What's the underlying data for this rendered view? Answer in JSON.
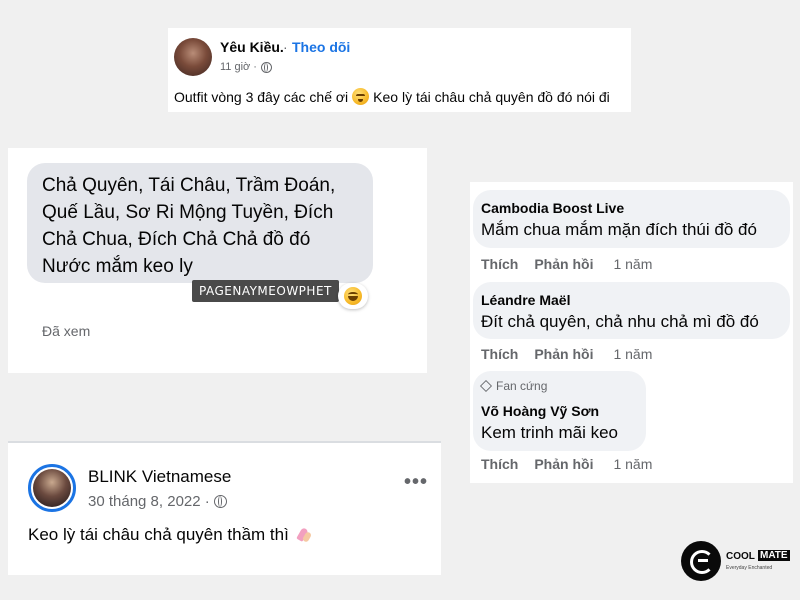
{
  "colors": {
    "background": "#f0f0f0",
    "link_blue": "#1b74e4",
    "secondary_text": "#65676b",
    "bubble_gray": "#e4e6eb",
    "comment_bubble": "#f0f2f5"
  },
  "post_top": {
    "author": "Yêu Kiều.",
    "separator": "·",
    "follow": "Theo dõi",
    "time": "11 giờ ·",
    "caption_before": "Outfit vòng 3 đây các chế ơi",
    "caption_after": "Keo lỳ tái châu chả quyên đồ đó nói đi",
    "icons": [
      "globe-icon",
      "sleepy-emoji-icon"
    ]
  },
  "message": {
    "lines": [
      "Chả Quyên, Tái Châu, Trầm Đoán,",
      "Quế Lầu, Sơ Ri Mộng Tuyền, Đích",
      "Chả Chua, Đích Chả Chả đồ đó",
      "Nước mắm keo ly"
    ],
    "watermark": "PAGENAYMEOWPHET",
    "reaction_icon": "laughing-emoji-icon",
    "seen": "Đã xem"
  },
  "post_blink": {
    "author": "BLINK Vietnamese",
    "date": "30 tháng 8, 2022 ·",
    "more": "•••",
    "caption": "Keo lỳ tái châu chả quyên thầm thì",
    "icons": [
      "globe-icon",
      "nail-polish-icon",
      "more-options-icon"
    ]
  },
  "comments": [
    {
      "name": "Cambodia Boost Live",
      "text": "Mắm chua mắm mặn đích thúi đồ đó",
      "like": "Thích",
      "reply": "Phản hồi",
      "time": "1 năm"
    },
    {
      "name": "Léandre Maël",
      "text": "Đít chả quyên, chả nhu chả mì đồ đó",
      "like": "Thích",
      "reply": "Phản hồi",
      "time": "1 năm"
    },
    {
      "badge": "Fan cứng",
      "name": "Võ Hoàng Vỹ Sơn",
      "text": "Kem trinh mãi keo",
      "like": "Thích",
      "reply": "Phản hồi",
      "time": "1 năm"
    }
  ],
  "logo": {
    "word1": "COOL",
    "word2": "MATE",
    "tagline": "Everyday Enchanted"
  }
}
